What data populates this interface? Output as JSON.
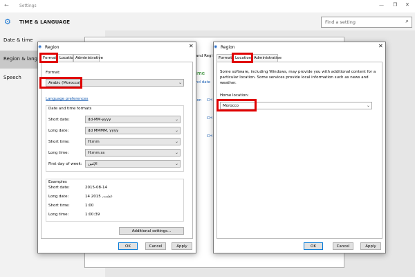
{
  "settings": {
    "app_title": "Settings",
    "heading": "TIME & LANGUAGE",
    "search_placeholder": "Find a setting",
    "nav": [
      {
        "label": "Date & time"
      },
      {
        "label": "Region & langu"
      },
      {
        "label": "Speech"
      }
    ],
    "bg_fragments": [
      "and Regi",
      "ime",
      "nd date",
      "ion",
      "CH",
      "CH",
      "CH"
    ]
  },
  "region_left": {
    "title": "Region",
    "tabs": [
      "Formats",
      "Location",
      "Administrative"
    ],
    "format_label": "Format:",
    "format_value": "Arabic (Morocco)",
    "language_prefs": "Language preferences",
    "dt_group_label": "Date and time formats",
    "rows": [
      {
        "label": "Short date:",
        "value": "dd-MM-yyyy"
      },
      {
        "label": "Long date:",
        "value": "dd MMMM, yyyy"
      },
      {
        "label": "Short time:",
        "value": "H:mm"
      },
      {
        "label": "Long time:",
        "value": "H:mm:ss"
      },
      {
        "label": "First day of week:",
        "value": "الإثنين"
      }
    ],
    "examples_label": "Examples",
    "examples": [
      {
        "label": "Short date:",
        "value": "2015-08-14"
      },
      {
        "label": "Long date:",
        "value": "14 غشت, 2015"
      },
      {
        "label": "Short time:",
        "value": "1:00"
      },
      {
        "label": "Long time:",
        "value": "1:00:39"
      }
    ],
    "additional_button": "Additional settings...",
    "ok": "OK",
    "cancel": "Cancel",
    "apply": "Apply"
  },
  "region_right": {
    "title": "Region",
    "tabs": [
      "Formats",
      "Location",
      "Administrative"
    ],
    "description": "Some software, including Windows, may provide you with additional content for a particular location. Some services provide local information such as news and weather.",
    "home_label": "Home location:",
    "home_value": "Morocco",
    "ok": "OK",
    "cancel": "Cancel",
    "apply": "Apply"
  },
  "colors": {
    "highlight": "#e00000",
    "accent": "#0078d7",
    "link": "#1a5fb4"
  }
}
